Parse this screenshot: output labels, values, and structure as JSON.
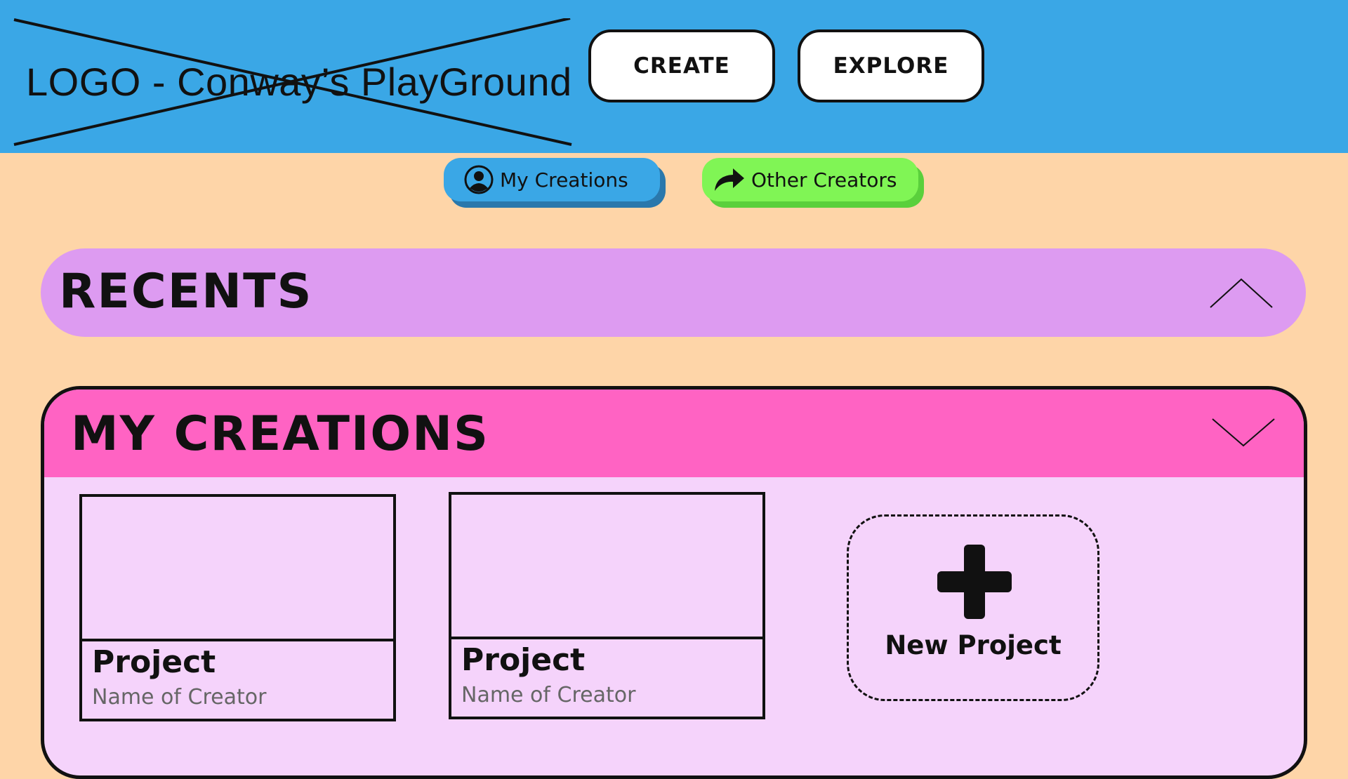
{
  "header": {
    "logo_text": "LOGO - Conway’s PlayGround",
    "nav": {
      "create_label": "CREATE",
      "explore_label": "EXPLORE"
    }
  },
  "filters": {
    "my_creations_label": "My Creations",
    "my_creations_icon": "user-circle-icon",
    "other_creators_label": "Other Creators",
    "other_creators_icon": "share-arrow-icon"
  },
  "sections": {
    "recents": {
      "title": "RECENTS",
      "toggle_icon": "chevron-up-icon"
    },
    "my_creations": {
      "title": "MY CREATIONS",
      "toggle_icon": "chevron-down-icon",
      "projects": [
        {
          "title": "Project",
          "creator": "Name of Creator"
        },
        {
          "title": "Project",
          "creator": "Name of Creator"
        }
      ],
      "new_project_label": "New Project",
      "new_project_icon": "plus-icon"
    }
  },
  "colors": {
    "header_bg": "#3aa7e6",
    "page_bg": "#fed5a8",
    "recents_bg": "#dd9bf1",
    "my_creations_header_bg": "#ff63c3",
    "my_creations_body_bg": "#f5d3fb",
    "my_creations_pill_bg": "#3aa7e6",
    "other_creators_pill_bg": "#80f555"
  }
}
